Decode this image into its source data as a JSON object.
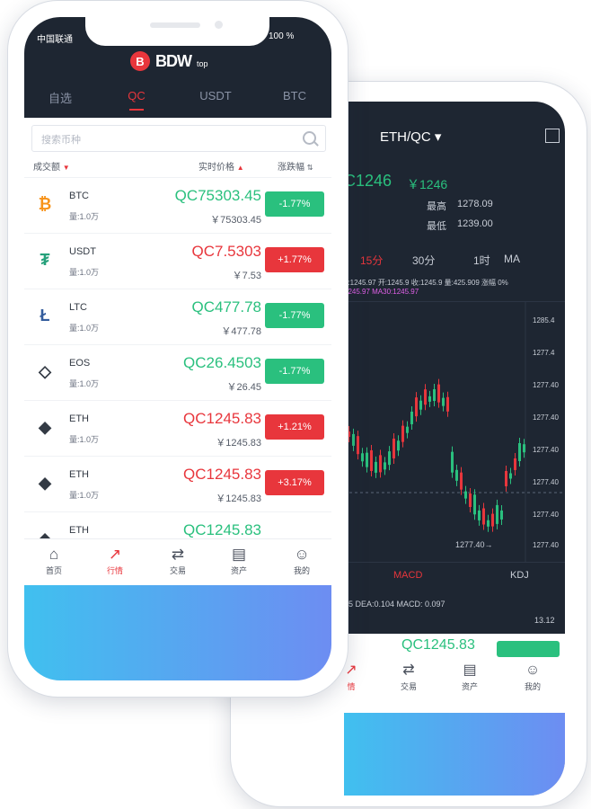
{
  "colors": {
    "brand": "#e8363c",
    "up": "#e8363c",
    "down": "#2ac07e",
    "dark": "#1e2632",
    "gradient_start": "#40c0ef",
    "gradient_end": "#6d8df2"
  },
  "front": {
    "status": {
      "carrier": "中国联通",
      "battery": "100 %"
    },
    "logo": {
      "mark": "B",
      "text": "BDW",
      "suffix": "top"
    },
    "tabs": [
      {
        "label": "自选"
      },
      {
        "label": "QC"
      },
      {
        "label": "USDT"
      },
      {
        "label": "BTC"
      }
    ],
    "search": {
      "placeholder": "搜索币种"
    },
    "columns": {
      "volume": "成交额",
      "price": "实时价格",
      "change": "涨跌幅"
    },
    "rows": [
      {
        "icon": "bitcoin-icon",
        "glyph": "₿",
        "symbol": "BTC",
        "volume": "量:1.0万",
        "qc": "QC75303.45",
        "cny": "￥75303.45",
        "change": "-1.77%"
      },
      {
        "icon": "tether-icon",
        "glyph": "₮",
        "symbol": "USDT",
        "volume": "量:1.0万",
        "qc": "QC7.5303",
        "cny": "￥7.53",
        "change": "+1.77%"
      },
      {
        "icon": "litecoin-icon",
        "glyph": "Ł",
        "symbol": "LTC",
        "volume": "量:1.0万",
        "qc": "QC477.78",
        "cny": "￥477.78",
        "change": "-1.77%"
      },
      {
        "icon": "eos-icon",
        "glyph": "◇",
        "symbol": "EOS",
        "volume": "量:1.0万",
        "qc": "QC26.4503",
        "cny": "￥26.45",
        "change": "-1.77%"
      },
      {
        "icon": "ethereum-icon",
        "glyph": "◆",
        "symbol": "ETH",
        "volume": "量:1.0万",
        "qc": "QC1245.83",
        "cny": "￥1245.83",
        "change": "+1.21%"
      },
      {
        "icon": "ethereum-icon",
        "glyph": "◆",
        "symbol": "ETH",
        "volume": "量:1.0万",
        "qc": "QC1245.83",
        "cny": "￥1245.83",
        "change": "+3.17%"
      },
      {
        "icon": "ethereum-icon",
        "glyph": "◆",
        "symbol": "ETH",
        "volume": "",
        "qc": "QC1245.83",
        "cny": "",
        "change": ""
      }
    ],
    "nav": [
      {
        "icon": "home-icon",
        "glyph": "⌂",
        "label": "首页"
      },
      {
        "icon": "market-icon",
        "glyph": "📈",
        "label": "行情"
      },
      {
        "icon": "trade-icon",
        "glyph": "⇄",
        "label": "交易"
      },
      {
        "icon": "assets-icon",
        "glyph": "▤",
        "label": "资产"
      },
      {
        "icon": "profile-icon",
        "glyph": "☺",
        "label": "我的"
      }
    ]
  },
  "back": {
    "pair": "ETH/QC",
    "price": "C1246",
    "cny": "￥1246",
    "high_label": "最高",
    "high": "1278.09",
    "low_label": "最低",
    "low": "1239.00",
    "timeframes": [
      {
        "label": "15分"
      },
      {
        "label": "30分"
      },
      {
        "label": "1时"
      },
      {
        "label": "MA"
      }
    ],
    "ma_line1": "7:1245.97 开:1245.9 收:1245.9 量:425.909 涨幅 0%",
    "ma_line2": "1245.97 MA30:1245.97",
    "y_labels": [
      "1285.4",
      "1277.4",
      "1277.40",
      "1277.40",
      "1277.40",
      "1277.40",
      "1277.40",
      "1277.40"
    ],
    "marker": "1277.40→",
    "macd": "MACD",
    "kdj": "KDJ",
    "dea": "15 DEA:0.104 MACD: 0.097",
    "axis_value": "13.12",
    "bottom_qc": "QC1245.83",
    "nav": [
      {
        "icon": "market-icon",
        "label": "情"
      },
      {
        "icon": "trade-icon",
        "label": "交易"
      },
      {
        "icon": "assets-icon",
        "label": "资产"
      },
      {
        "icon": "profile-icon",
        "label": "我的"
      }
    ]
  }
}
